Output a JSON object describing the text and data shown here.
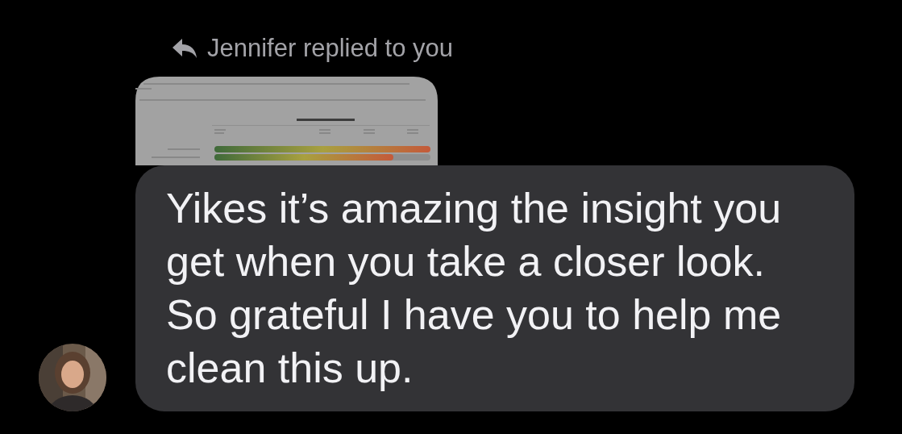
{
  "reply_header": {
    "text": "Jennifer replied to you"
  },
  "replied_image": {
    "kind": "document"
  },
  "message": {
    "text": "Yikes it’s amazing the insight you get when you take a closer look. So grateful I have you to help me clean this up."
  }
}
